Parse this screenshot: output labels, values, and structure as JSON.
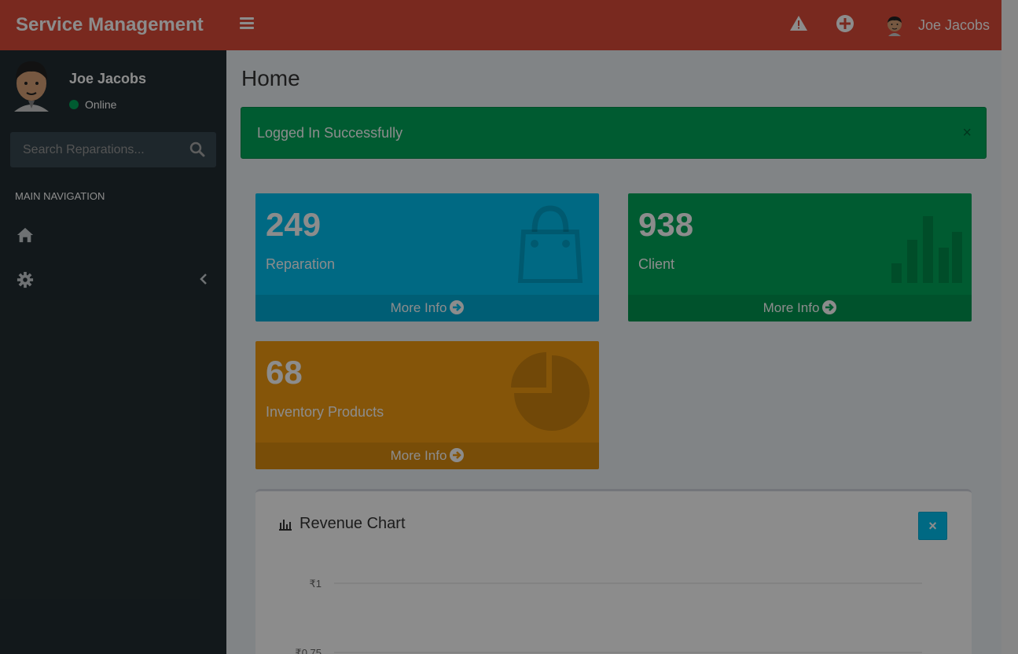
{
  "app": {
    "brand": "Service Management"
  },
  "header": {
    "user_name": "Joe Jacobs"
  },
  "sidebar": {
    "user_name": "Joe Jacobs",
    "status": "Online",
    "search_placeholder": "Search Reparations...",
    "nav_header": "MAIN NAVIGATION",
    "items": [
      {
        "icon": "home-icon"
      },
      {
        "icon": "gear-icon"
      }
    ]
  },
  "page": {
    "title": "Home",
    "alert": "Logged In Successfully",
    "alert_close": "×"
  },
  "stats": [
    {
      "value": "249",
      "label": "Reparation",
      "footer": "More Info",
      "color": "#00c0ef",
      "icon": "shopping-bag-icon"
    },
    {
      "value": "938",
      "label": "Client",
      "footer": "More Info",
      "color": "#00a65a",
      "icon": "bar-chart-icon"
    },
    {
      "value": "68",
      "label": "Inventory Products",
      "footer": "More Info",
      "color": "#f39c12",
      "icon": "pie-chart-icon"
    }
  ],
  "revenue": {
    "title": "Revenue Chart",
    "close": "×"
  },
  "chart_data": {
    "type": "line",
    "title": "Revenue Chart",
    "y_ticks": [
      "₹1",
      "₹0.75"
    ],
    "ylim": [
      0.75,
      1
    ],
    "grid": true
  }
}
